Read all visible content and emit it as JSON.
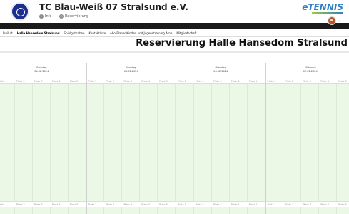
{
  "club": {
    "name": "TC Blau-Weiß 07 Stralsund e.V.",
    "info_label": "Info",
    "reservation_label": "Reservierung"
  },
  "brand": {
    "name": "eTENNIS"
  },
  "nav": {
    "items": [
      {
        "label": "Freiluft"
      },
      {
        "label": "Halle Hansedom Stralsund"
      },
      {
        "label": "Spielguthaben"
      },
      {
        "label": "Kontaktliste"
      },
      {
        "label": "Abo-Planer Kinder- und Jugendtraining Arne"
      },
      {
        "label": "Mitgliedschaft"
      }
    ]
  },
  "page": {
    "title": "Reservierung Halle Hansedom Stralsund"
  },
  "days": [
    {
      "name": "Sonntag",
      "date": "04.02.2024"
    },
    {
      "name": "Montag",
      "date": "05.02.2024"
    },
    {
      "name": "Dienstag",
      "date": "06.02.2024"
    },
    {
      "name": "Mittwoch",
      "date": "07.02.2024"
    }
  ],
  "courts": [
    "Platz 1",
    "Platz 2",
    "Platz 3",
    "Platz 4",
    "Platz 5"
  ],
  "colors": {
    "free_slot": "#ecf8e6",
    "dark_bar": "#1a1a1a",
    "brand_blue": "#2d7fc1"
  }
}
